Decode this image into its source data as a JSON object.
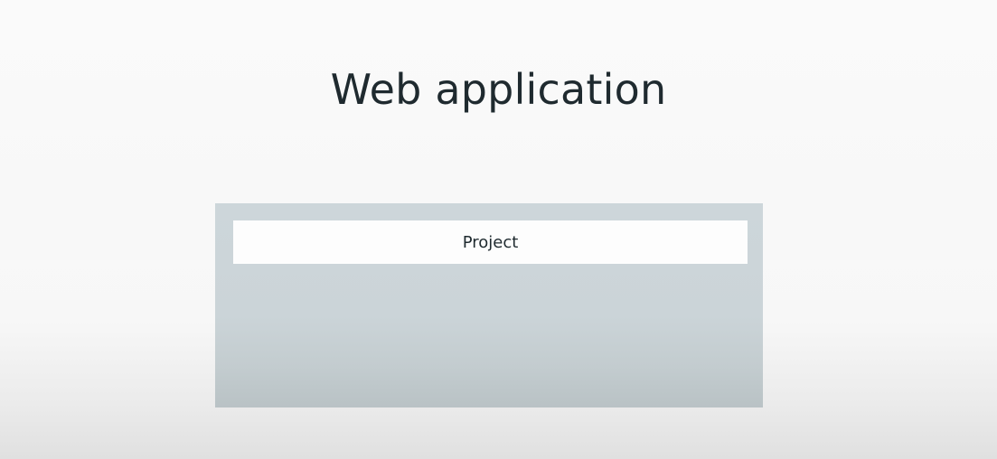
{
  "slide": {
    "title": "Web application"
  },
  "diagram": {
    "container": {
      "label": "Project"
    }
  },
  "colors": {
    "background": "#f7f7f7",
    "container": "#cbd4d8",
    "box": "#fdfdfd",
    "text": "#1f2a2f"
  }
}
